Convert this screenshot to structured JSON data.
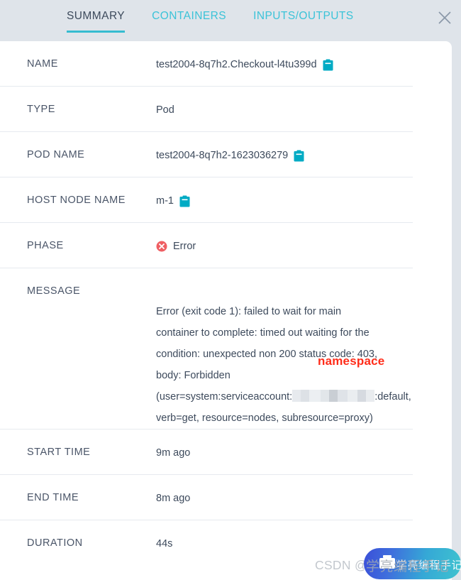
{
  "tabs": [
    {
      "label": "SUMMARY",
      "active": true
    },
    {
      "label": "CONTAINERS",
      "active": false
    },
    {
      "label": "INPUTS/OUTPUTS",
      "active": false
    }
  ],
  "close_label": "×",
  "colors": {
    "accent_teal": "#35bcd0",
    "tab_inactive": "#3bc3d8",
    "tab_active": "#3d4a5c",
    "panel_bg": "#ffffff",
    "page_bg": "#dfe4ea",
    "error_red": "#ef5f63",
    "copy_icon": "#00abc4",
    "annotation_red": "#ff2d1a"
  },
  "rows": {
    "name": {
      "label": "NAME",
      "value": "test2004-8q7h2.Checkout-l4tu399d",
      "copy_icon": "clipboard-icon"
    },
    "type": {
      "label": "TYPE",
      "value": "Pod"
    },
    "pod_name": {
      "label": "POD NAME",
      "value": "test2004-8q7h2-1623036279",
      "copy_icon": "clipboard-icon"
    },
    "host_node_name": {
      "label": "HOST NODE NAME",
      "value": "m-1",
      "copy_icon": "clipboard-icon"
    },
    "phase": {
      "label": "PHASE",
      "value": "Error",
      "status_icon": "error-circle-icon"
    },
    "message": {
      "label": "MESSAGE",
      "lines": [
        "Error (exit code 1): failed to wait for main",
        "container to complete: timed out waiting for the",
        "condition: unexpected non 200 status code: 403,",
        "body: Forbidden"
      ],
      "redacted_line_prefix": "(user=system:serviceaccount:",
      "redacted_line_suffix": ":default,",
      "last_line": "verb=get, resource=nodes, subresource=proxy)",
      "annotation": "namespace"
    },
    "start_time": {
      "label": "START TIME",
      "value": "9m ago"
    },
    "end_time": {
      "label": "END TIME",
      "value": "8m ago"
    },
    "duration": {
      "label": "DURATION",
      "value": "44s"
    }
  },
  "watermark": {
    "text": "CSDN @学亮编程手记",
    "badge_text": "学亮编程手记",
    "badge_icon": "book-icon"
  }
}
